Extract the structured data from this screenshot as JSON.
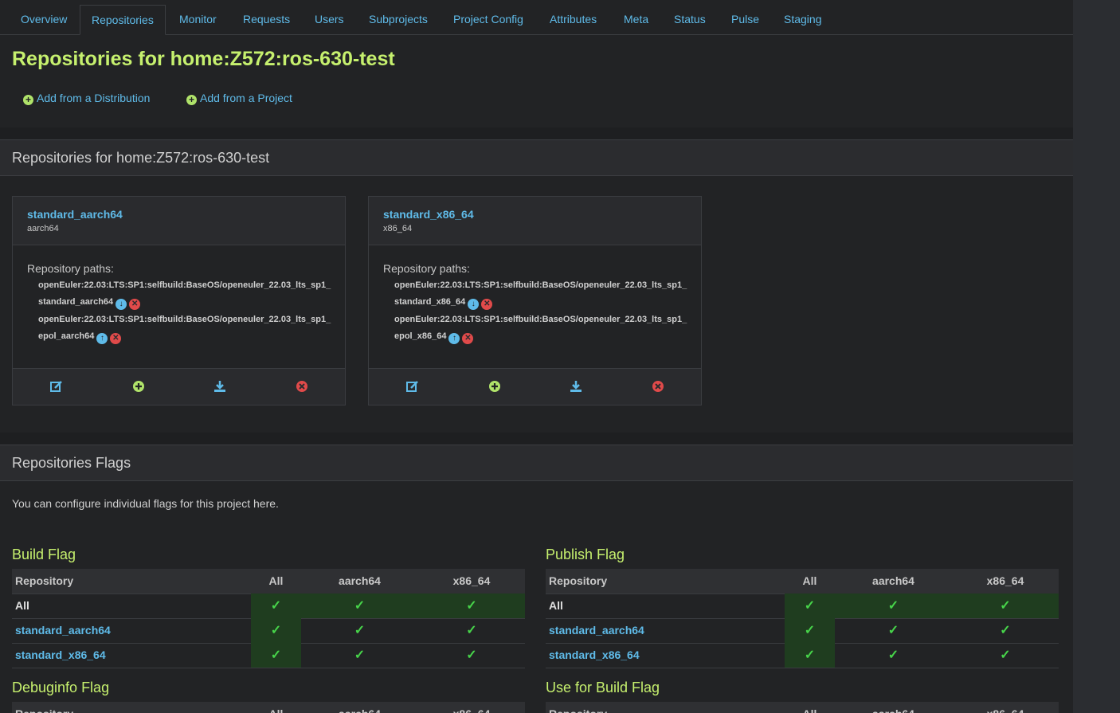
{
  "tabs": [
    "Overview",
    "Repositories",
    "Monitor",
    "Requests",
    "Users",
    "Subprojects",
    "Project Config",
    "Attributes",
    "Meta",
    "Status",
    "Pulse",
    "Staging"
  ],
  "page_title": "Repositories for home:Z572:ros-630-test",
  "add_links": {
    "distribution": "Add from a Distribution",
    "project": "Add from a Project"
  },
  "repos_section_title": "Repositories for home:Z572:ros-630-test",
  "repositories": [
    {
      "name": "standard_aarch64",
      "arch": "aarch64",
      "paths_label": "Repository paths:",
      "paths": [
        {
          "text": "openEuler:22.03:LTS:SP1:selfbuild:BaseOS/openeuler_22.03_lts_sp1_standard_aarch64",
          "move": "down"
        },
        {
          "text": "openEuler:22.03:LTS:SP1:selfbuild:BaseOS/openeuler_22.03_lts_sp1_epol_aarch64",
          "move": "up"
        }
      ]
    },
    {
      "name": "standard_x86_64",
      "arch": "x86_64",
      "paths_label": "Repository paths:",
      "paths": [
        {
          "text": "openEuler:22.03:LTS:SP1:selfbuild:BaseOS/openeuler_22.03_lts_sp1_standard_x86_64",
          "move": "down"
        },
        {
          "text": "openEuler:22.03:LTS:SP1:selfbuild:BaseOS/openeuler_22.03_lts_sp1_epol_x86_64",
          "move": "up"
        }
      ]
    }
  ],
  "flags_section_title": "Repositories Flags",
  "flags_description": "You can configure individual flags for this project here.",
  "flag_table_headers": [
    "Repository",
    "All",
    "aarch64",
    "x86_64"
  ],
  "flag_rows": [
    "All",
    "standard_aarch64",
    "standard_x86_64"
  ],
  "flags": [
    {
      "title": "Build Flag"
    },
    {
      "title": "Publish Flag"
    },
    {
      "title": "Debuginfo Flag"
    },
    {
      "title": "Use for Build Flag"
    }
  ],
  "colors": {
    "accent_link": "#5fbbe9",
    "title_green": "#c6f06e",
    "check_green": "#47d44a",
    "remove_red": "#e04a4a"
  }
}
